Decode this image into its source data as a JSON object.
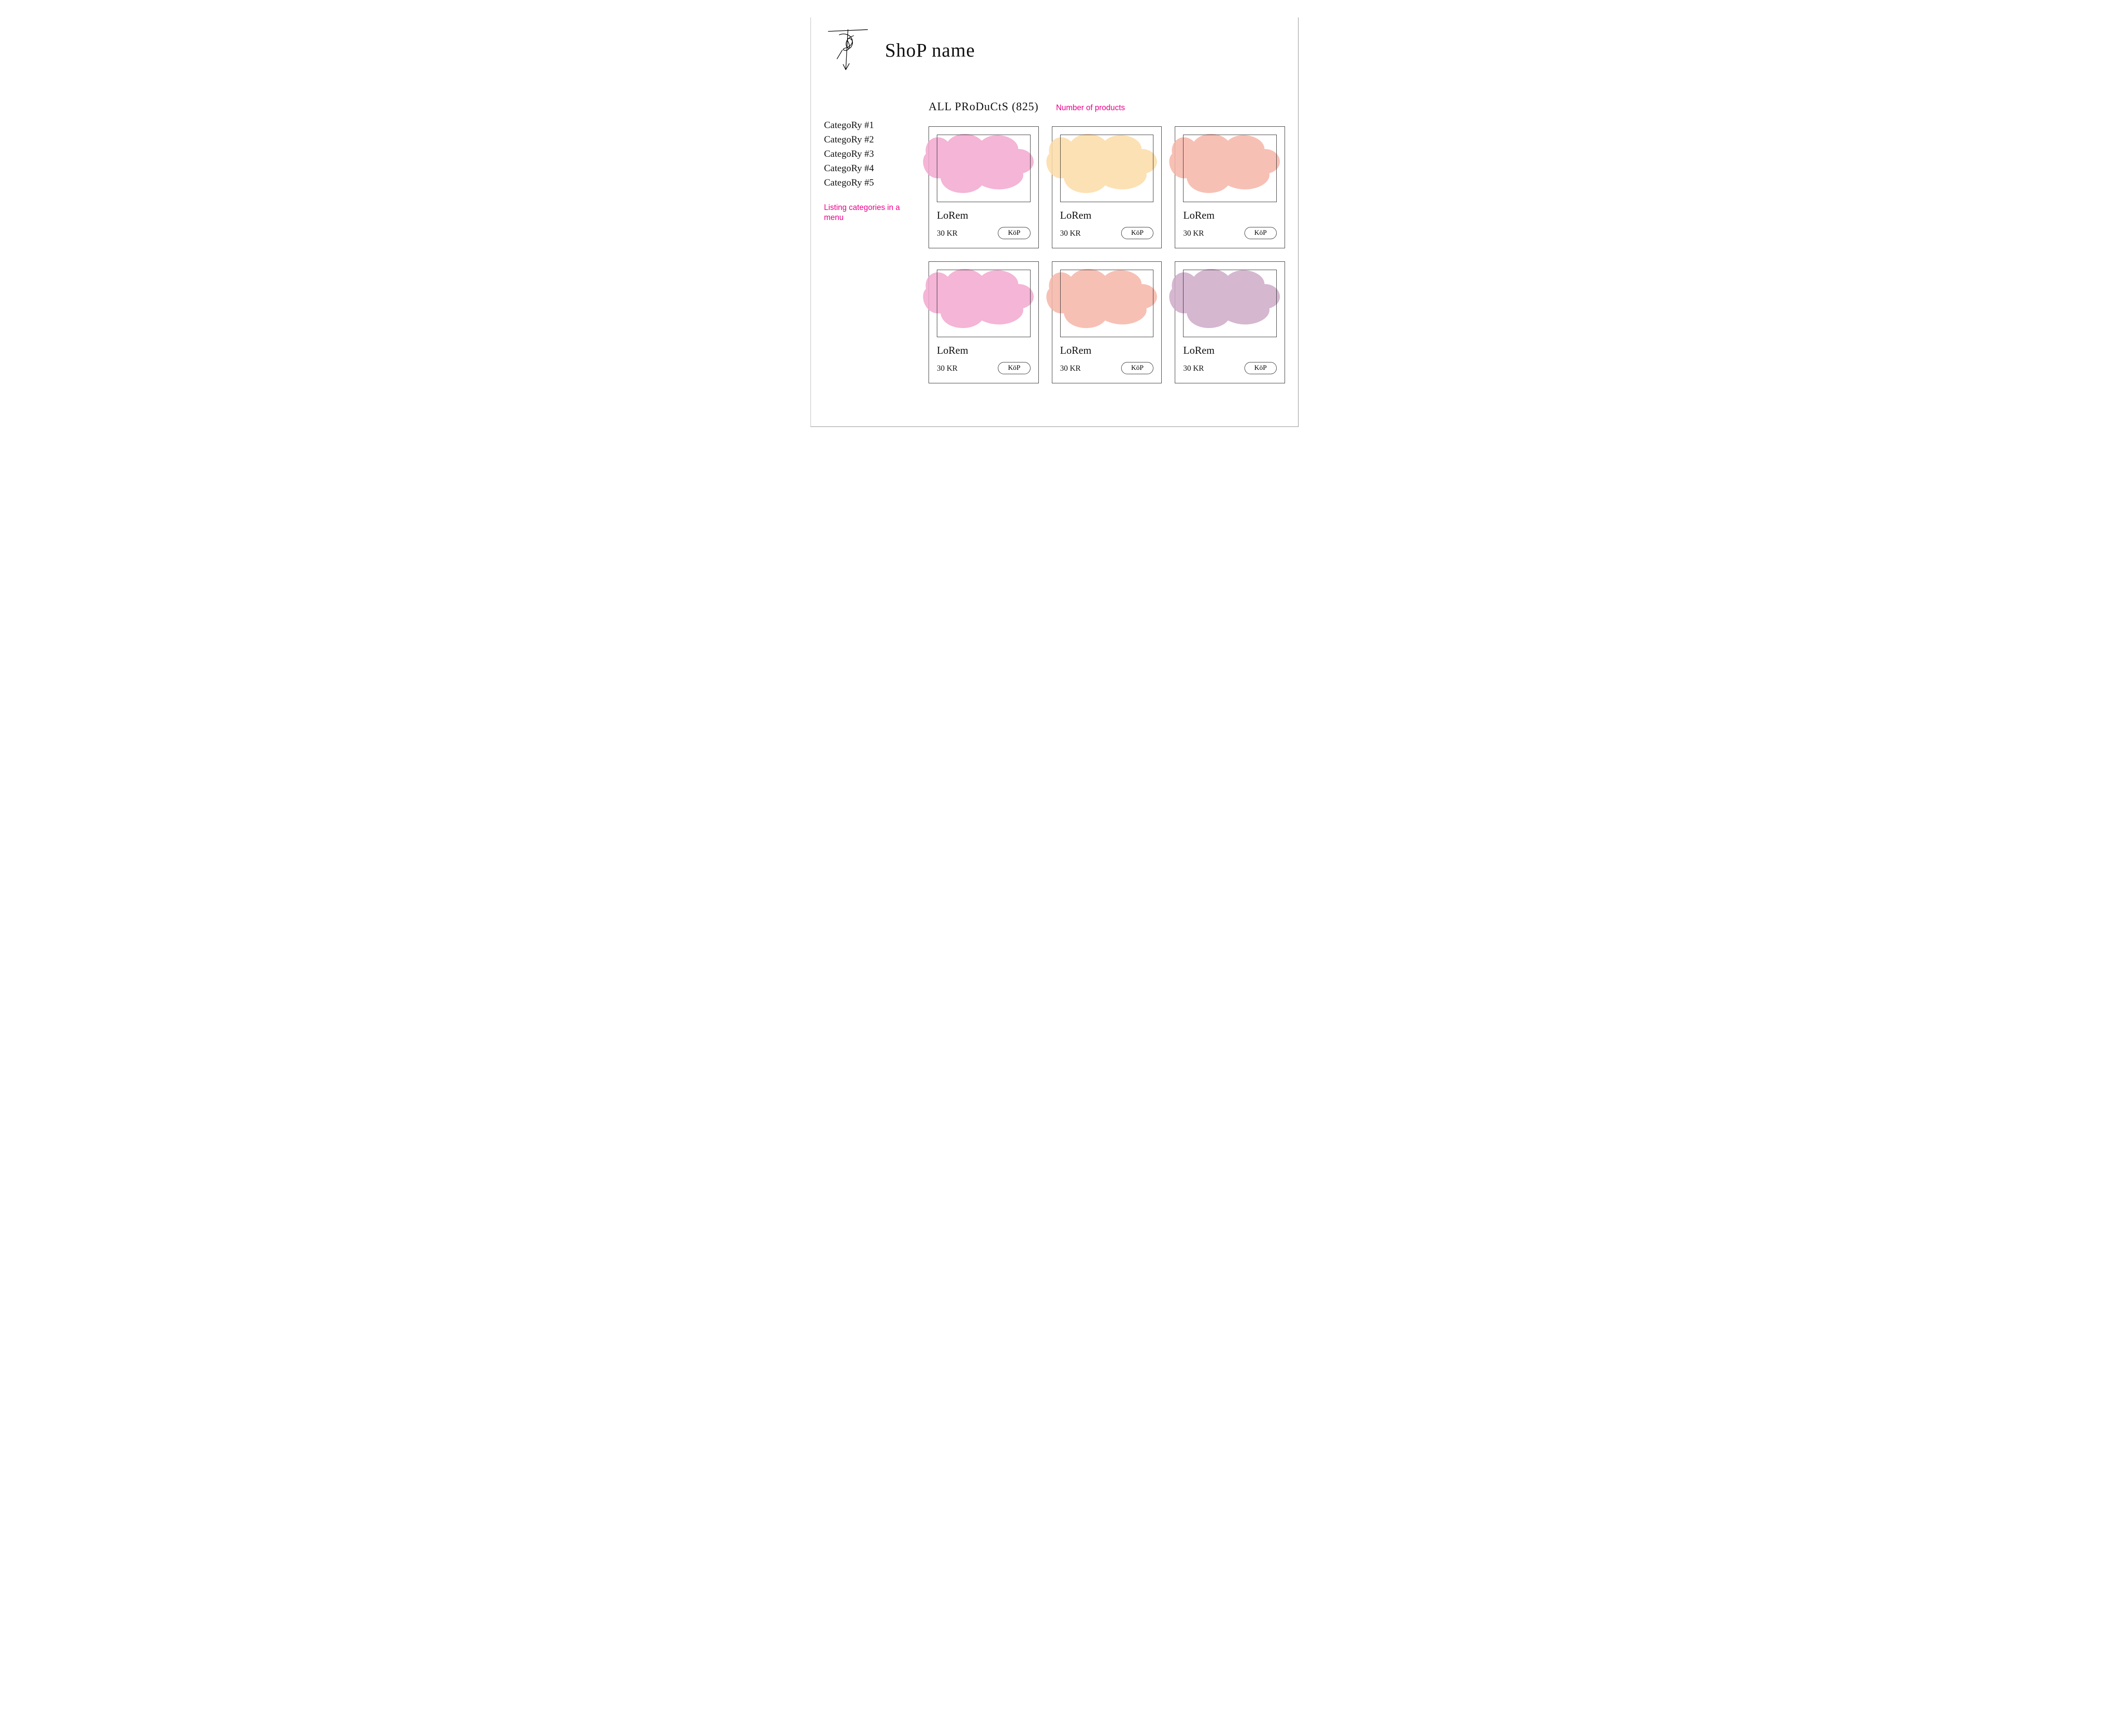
{
  "header": {
    "shop_title": "ShoP name"
  },
  "sidebar": {
    "items": [
      {
        "label": "CategoRy #1"
      },
      {
        "label": "CategoRy #2"
      },
      {
        "label": "CategoRy #3"
      },
      {
        "label": "CategoRy #4"
      },
      {
        "label": "CategoRy #5"
      }
    ],
    "annotation": "Listing categories in a menu"
  },
  "main": {
    "heading": "ALL PRoDuCtS (825)",
    "heading_annotation": "Number of products",
    "products": [
      {
        "title": "LoRem",
        "price": "30 KR",
        "buy_label": "KöP",
        "blob_color": "#f2a8cf"
      },
      {
        "title": "LoRem",
        "price": "30 KR",
        "buy_label": "KöP",
        "blob_color": "#fcdca7"
      },
      {
        "title": "LoRem",
        "price": "30 KR",
        "buy_label": "KöP",
        "blob_color": "#f6b5a8"
      },
      {
        "title": "LoRem",
        "price": "30 KR",
        "buy_label": "KöP",
        "blob_color": "#f2a8cf"
      },
      {
        "title": "LoRem",
        "price": "30 KR",
        "buy_label": "KöP",
        "blob_color": "#f6b5a8"
      },
      {
        "title": "LoRem",
        "price": "30 KR",
        "buy_label": "KöP",
        "blob_color": "#ceaac8"
      }
    ],
    "buy_button_color": "#c6e2cb"
  }
}
